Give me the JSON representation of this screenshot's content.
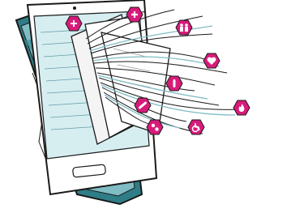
{
  "illustration": {
    "subject": "smartphone-with-cables-and-hexagon-icons",
    "colors": {
      "background": "#ffffff",
      "teal_light": "#d7eef1",
      "teal_mid": "#7fbcc4",
      "teal_dark": "#2f7d87",
      "ink": "#1a1a1a",
      "paper": "#f4f4f4",
      "magenta": "#d81b7a"
    },
    "badges": [
      {
        "icon": "medical-cross-icon"
      },
      {
        "icon": "plus-icon"
      },
      {
        "icon": "family-icon"
      },
      {
        "icon": "heart-icon"
      },
      {
        "icon": "pill-icon"
      },
      {
        "icon": "bandage-icon"
      },
      {
        "icon": "flame-icon"
      },
      {
        "icon": "tablets-icon"
      },
      {
        "icon": "wheelchair-icon"
      }
    ]
  }
}
